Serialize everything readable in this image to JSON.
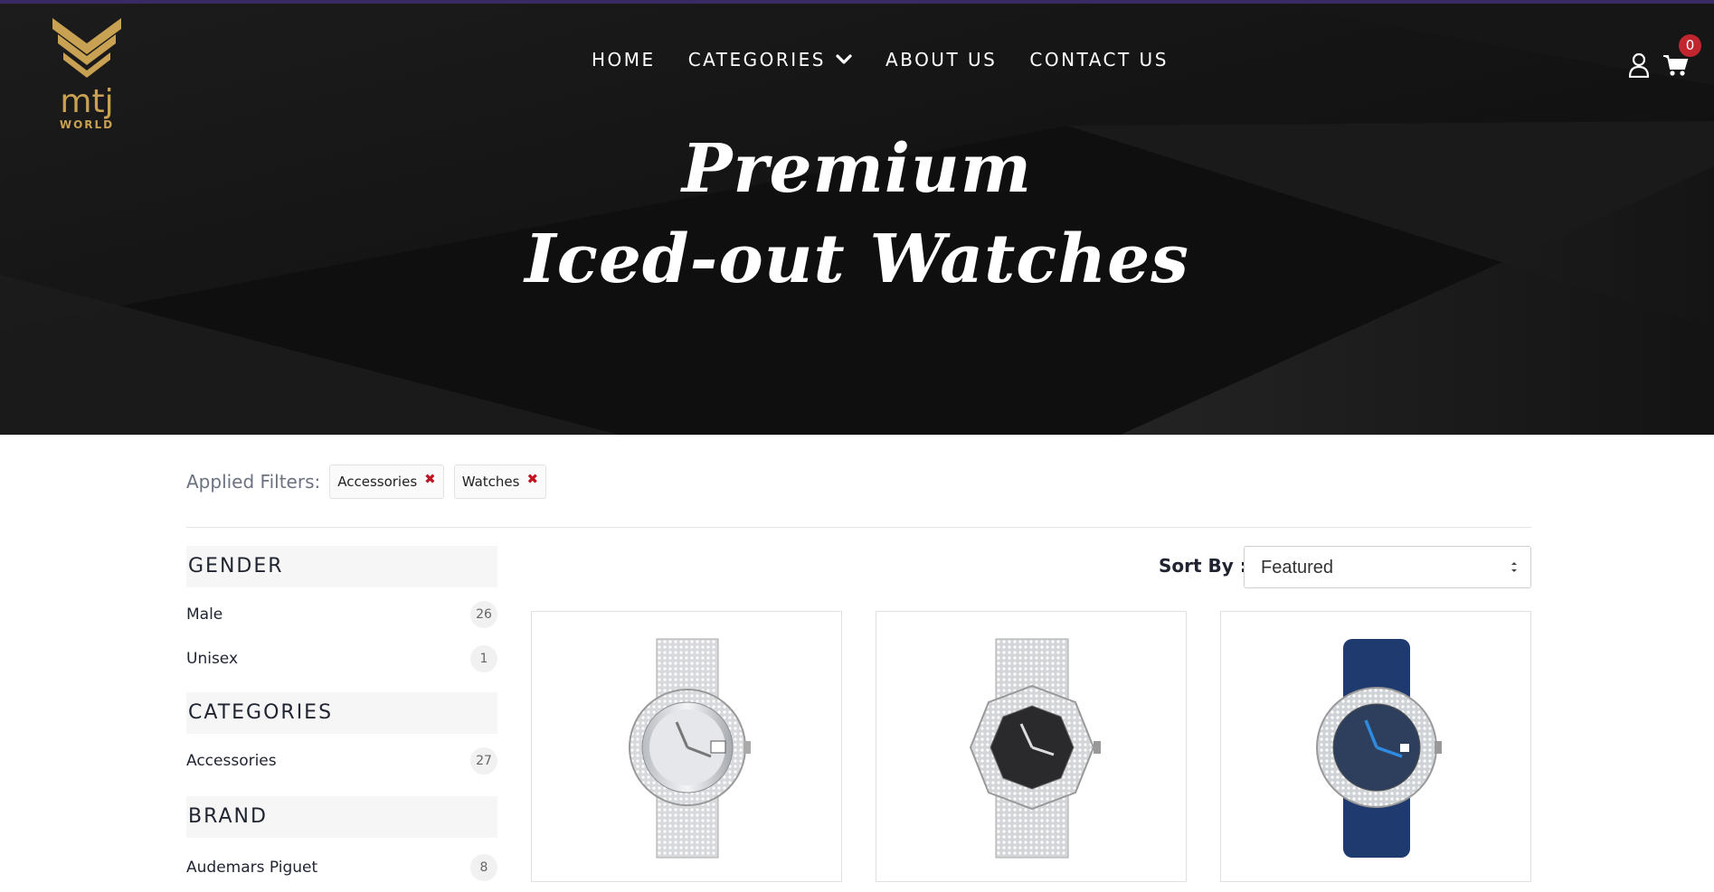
{
  "header": {
    "logo_text": "mtj",
    "logo_subtext": "WORLD",
    "nav": [
      {
        "label": "HOME"
      },
      {
        "label": "CATEGORIES"
      },
      {
        "label": "ABOUT US"
      },
      {
        "label": "CONTACT US"
      }
    ],
    "cart_count": "0",
    "icons": [
      "user-icon",
      "shopping-cart-icon",
      "chevron-down-icon"
    ]
  },
  "hero": {
    "line1": "Premium",
    "line2": "Iced-out  Watches"
  },
  "filters": {
    "label": "Applied Filters:",
    "chips": [
      {
        "label": "Accessories",
        "remove": "✖"
      },
      {
        "label": "Watches",
        "remove": "✖"
      }
    ]
  },
  "sidebar": {
    "gender": {
      "title": "GENDER",
      "items": [
        {
          "label": "Male",
          "count": "26"
        },
        {
          "label": "Unisex",
          "count": "1"
        }
      ]
    },
    "categories": {
      "title": "CATEGORIES",
      "items": [
        {
          "label": "Accessories",
          "count": "27"
        }
      ]
    },
    "brand": {
      "title": "BRAND",
      "items": [
        {
          "label": "Audemars Piguet",
          "count": "8"
        }
      ]
    }
  },
  "sort": {
    "label": "Sort By :",
    "selected": "Featured"
  },
  "colors": {
    "gold": "#c8a152",
    "badge_red": "#c1262f",
    "remove_red": "#c1121f",
    "hero_bg": "#111111",
    "strap_blue": "#1f3a6e"
  },
  "products": [
    {
      "watch": "silver-dial-datejust"
    },
    {
      "watch": "black-dial-royal-oak"
    },
    {
      "watch": "blue-dial-rubber-strap"
    }
  ]
}
